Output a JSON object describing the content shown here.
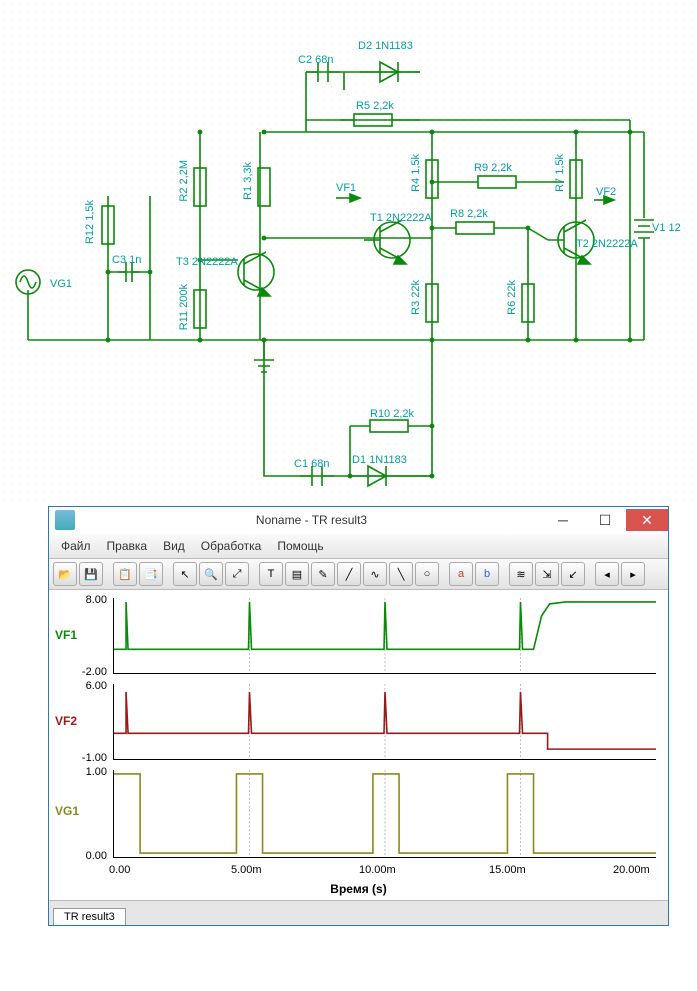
{
  "schematic": {
    "VG1": "VG1",
    "R12": "R12 1,5k",
    "C3": "C3 1n",
    "R2": "R2 2,2M",
    "R11": "R11 200k",
    "T3": "T3 2N2222A",
    "R1": "R1 3,3k",
    "C2": "C2 68n",
    "D2": "D2 1N1183",
    "R5": "R5 2,2k",
    "VF1": "VF1",
    "R4": "R4 1,5k",
    "T1": "T1 2N2222A",
    "R3": "R3 22k",
    "R8": "R8 2,2k",
    "R9": "R9 2,2k",
    "R6": "R6 22k",
    "VF2": "VF2",
    "R7": "R7 1,5k",
    "T2": "T2 2N2222A",
    "V1": "V1 12",
    "R10": "R10 2,2k",
    "D1": "D1 1N1183",
    "C1": "C1 68n"
  },
  "app": {
    "title": "Noname - TR result3",
    "menus": [
      "Файл",
      "Правка",
      "Вид",
      "Обработка",
      "Помощь"
    ],
    "tab": "TR result3",
    "xaxis_title": "Время (s)",
    "xticks": [
      "0.00",
      "5.00m",
      "10.00m",
      "15.00m",
      "20.00m"
    ],
    "plots": [
      {
        "name": "VF1",
        "color": "#0a8a0a",
        "ymin": "-2.00",
        "ymax": "8.00"
      },
      {
        "name": "VF2",
        "color": "#9a1a1a",
        "ymin": "-1.00",
        "ymax": "6.00"
      },
      {
        "name": "VG1",
        "color": "#8a8a1a",
        "ymin": "0.00",
        "ymax": "1.00"
      }
    ]
  },
  "chart_data": [
    {
      "type": "line",
      "title": "VF1",
      "ylim": [
        -2,
        8
      ],
      "xlim": [
        0,
        0.02
      ],
      "series": [
        {
          "name": "VF1",
          "mode": "pulse",
          "baseline": 1.0,
          "peak": 8.0,
          "pulses": [
            0.0005,
            0.005,
            0.01,
            0.015
          ],
          "step_at": 0.0155,
          "step_to": 8.0
        }
      ],
      "xlabel": "Время (s)",
      "ylabel": ""
    },
    {
      "type": "line",
      "title": "VF2",
      "ylim": [
        -1,
        6
      ],
      "xlim": [
        0,
        0.02
      ],
      "series": [
        {
          "name": "VF2",
          "mode": "pulse",
          "baseline": 1.0,
          "peak": 5.5,
          "pulses": [
            0.0005,
            0.005,
            0.01,
            0.015
          ],
          "drop_at": 0.016,
          "drop_to": 0.2
        }
      ],
      "xlabel": "Время (s)",
      "ylabel": ""
    },
    {
      "type": "line",
      "title": "VG1",
      "ylim": [
        0,
        1
      ],
      "xlim": [
        0,
        0.02
      ],
      "series": [
        {
          "name": "VG1",
          "mode": "square",
          "low": 0.0,
          "high": 1.0,
          "edges": [
            [
              0.0,
              0.001
            ],
            [
              0.0045,
              0.0055
            ],
            [
              0.0095,
              0.0105
            ],
            [
              0.0145,
              0.0155
            ]
          ]
        }
      ],
      "xlabel": "Время (s)",
      "ylabel": ""
    }
  ]
}
